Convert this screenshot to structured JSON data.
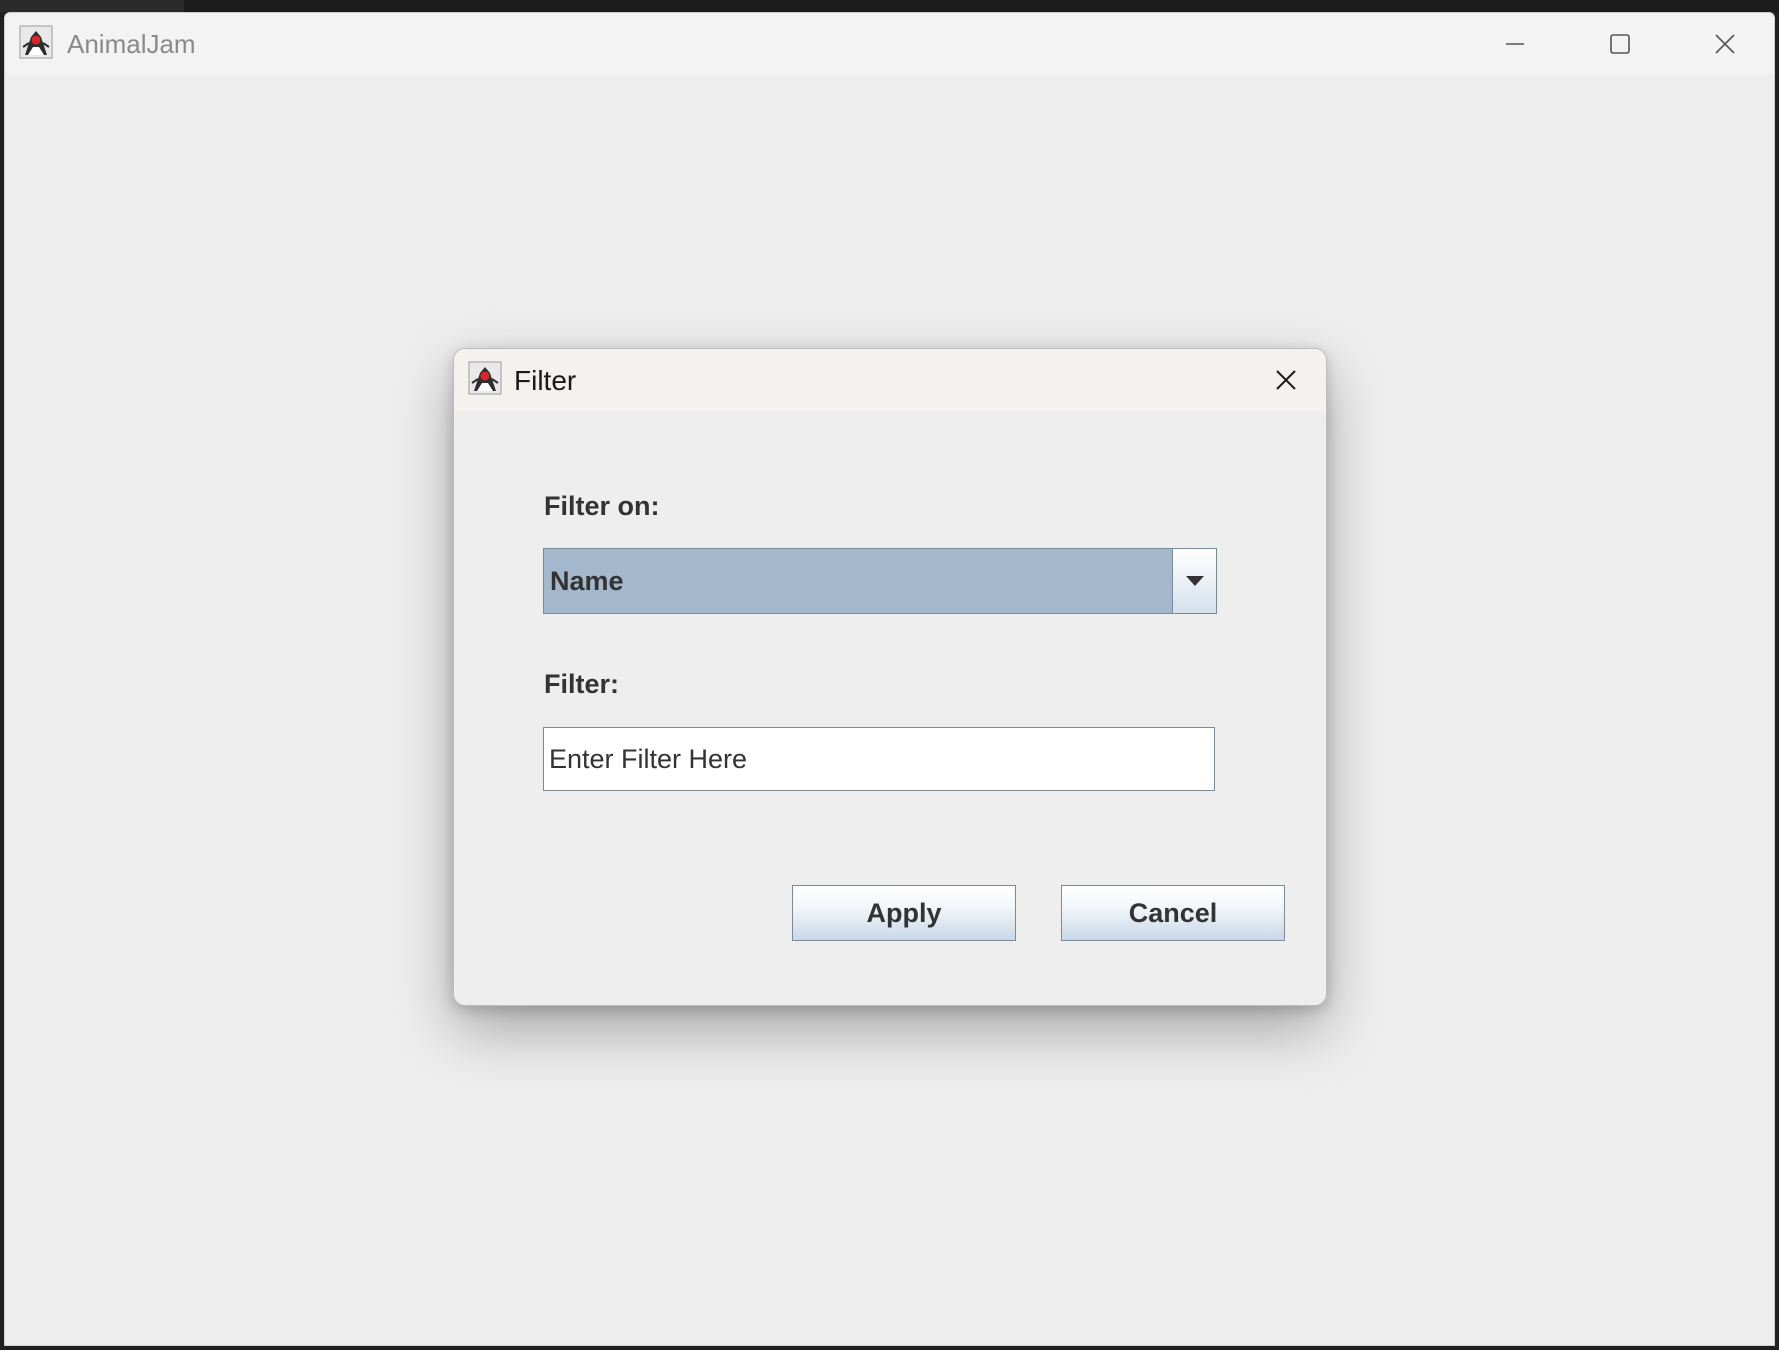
{
  "main_window": {
    "title": "AnimalJam",
    "icon": "java-duke-icon",
    "controls": [
      "minimize-icon",
      "maximize-icon",
      "close-icon"
    ]
  },
  "dialog": {
    "title": "Filter",
    "icon": "java-duke-icon",
    "filter_on_label": "Filter on:",
    "filter_on_selected": "Name",
    "filter_label": "Filter:",
    "filter_placeholder": "Enter Filter Here",
    "filter_value": "",
    "apply_label": "Apply",
    "cancel_label": "Cancel"
  },
  "colors": {
    "combo_selected_bg": "#a3b8cc",
    "background": "#eeeeee"
  }
}
